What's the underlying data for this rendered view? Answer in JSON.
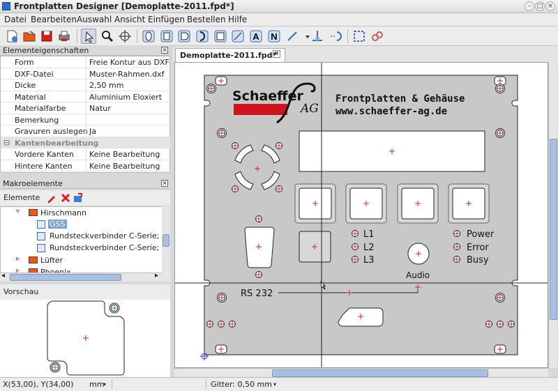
{
  "window": {
    "title": "Frontplatten Designer [Demoplatte-2011.fpd*]",
    "btn_min": "–",
    "btn_max": "□",
    "btn_close": "×"
  },
  "menu": [
    "Datei",
    "Bearbeiten",
    "Auswahl",
    "Ansicht",
    "Einfügen",
    "Bestellen",
    "Hilfe"
  ],
  "toolbar": {
    "icons": [
      "new-file-icon",
      "open-folder-icon",
      "save-icon",
      "print-icon",
      "pointer-icon",
      "zoom-icon",
      "crosshair-icon",
      "shape-round-icon",
      "shape-square-icon",
      "shape-d-icon",
      "shape-right-icon",
      "shape-rect-icon",
      "shape-pocket-icon",
      "text-icon",
      "spline-icon",
      "line-icon",
      "dropdown-arrow-icon",
      "cut-icon",
      "cut-mark-icon",
      "select-region-icon",
      "link-icon"
    ],
    "letters": {
      "text": "A",
      "spline": "N"
    }
  },
  "properties": {
    "title": "Elementeigenschaften",
    "close": "×",
    "rows": [
      {
        "key": "Form",
        "value": "Freie Kontur aus DXF-D"
      },
      {
        "key": "DXF-Datei",
        "value": "Muster-Rahmen.dxf"
      },
      {
        "key": "Dicke",
        "value": "2,50 mm"
      },
      {
        "key": "Material",
        "value": "Aluminium Eloxiert"
      },
      {
        "key": "Materialfarbe",
        "value": "Natur"
      },
      {
        "key": "Bemerkung",
        "value": ""
      },
      {
        "key": "Gravuren auslegen",
        "value": "Ja"
      }
    ],
    "group": {
      "label": "Kantenbearbeitung",
      "toggle": "⊟"
    },
    "rows2": [
      {
        "key": "Vordere Kanten",
        "value": "Keine Bearbeitung"
      },
      {
        "key": "Hintere Kanten",
        "value": "Keine Bearbeitung"
      }
    ]
  },
  "makro": {
    "title": "Makroelemente",
    "close": "×",
    "label": "Elemente",
    "tree": [
      {
        "label": "Hirschmann",
        "arrow": "▿",
        "indent": 22,
        "type": "folder"
      },
      {
        "label": "GSS",
        "indent": 52,
        "type": "item",
        "selected": true
      },
      {
        "label": "Rundsteckverbinder C-Serie; Bohrbild",
        "indent": 52,
        "type": "item"
      },
      {
        "label": "Rundsteckverbinder C-Serie; Bohrbild",
        "indent": 52,
        "type": "item"
      },
      {
        "label": "Lüfter",
        "arrow": "▹",
        "indent": 22,
        "type": "folder"
      },
      {
        "label": "Phoenix",
        "arrow": "▹",
        "indent": 22,
        "type": "folder"
      }
    ],
    "scroll_left": "◂",
    "scroll_right": "▸"
  },
  "preview": {
    "title": "Vorschau"
  },
  "document": {
    "tab": "Demoplatte-2011.fpd*",
    "tab_close": "×"
  },
  "panel": {
    "logo_name": "Schaeffer",
    "logo_ag": "AG",
    "engraving": [
      "Frontplatten & Gehäuse",
      "www.schaeffer-ag.de"
    ],
    "leds": [
      "L1",
      "L2",
      "L3"
    ],
    "status": [
      "Power",
      "Error",
      "Busy"
    ],
    "audio": "Audio",
    "rs": "RS 232"
  },
  "status": {
    "coords": "X(53,00), Y(34,00)",
    "unit": "mm",
    "grid": "Gitter: 0,50 mm",
    "arrow": "▾"
  },
  "colors": {
    "accent": "#d0141e",
    "panel": "#c8c8c8"
  }
}
